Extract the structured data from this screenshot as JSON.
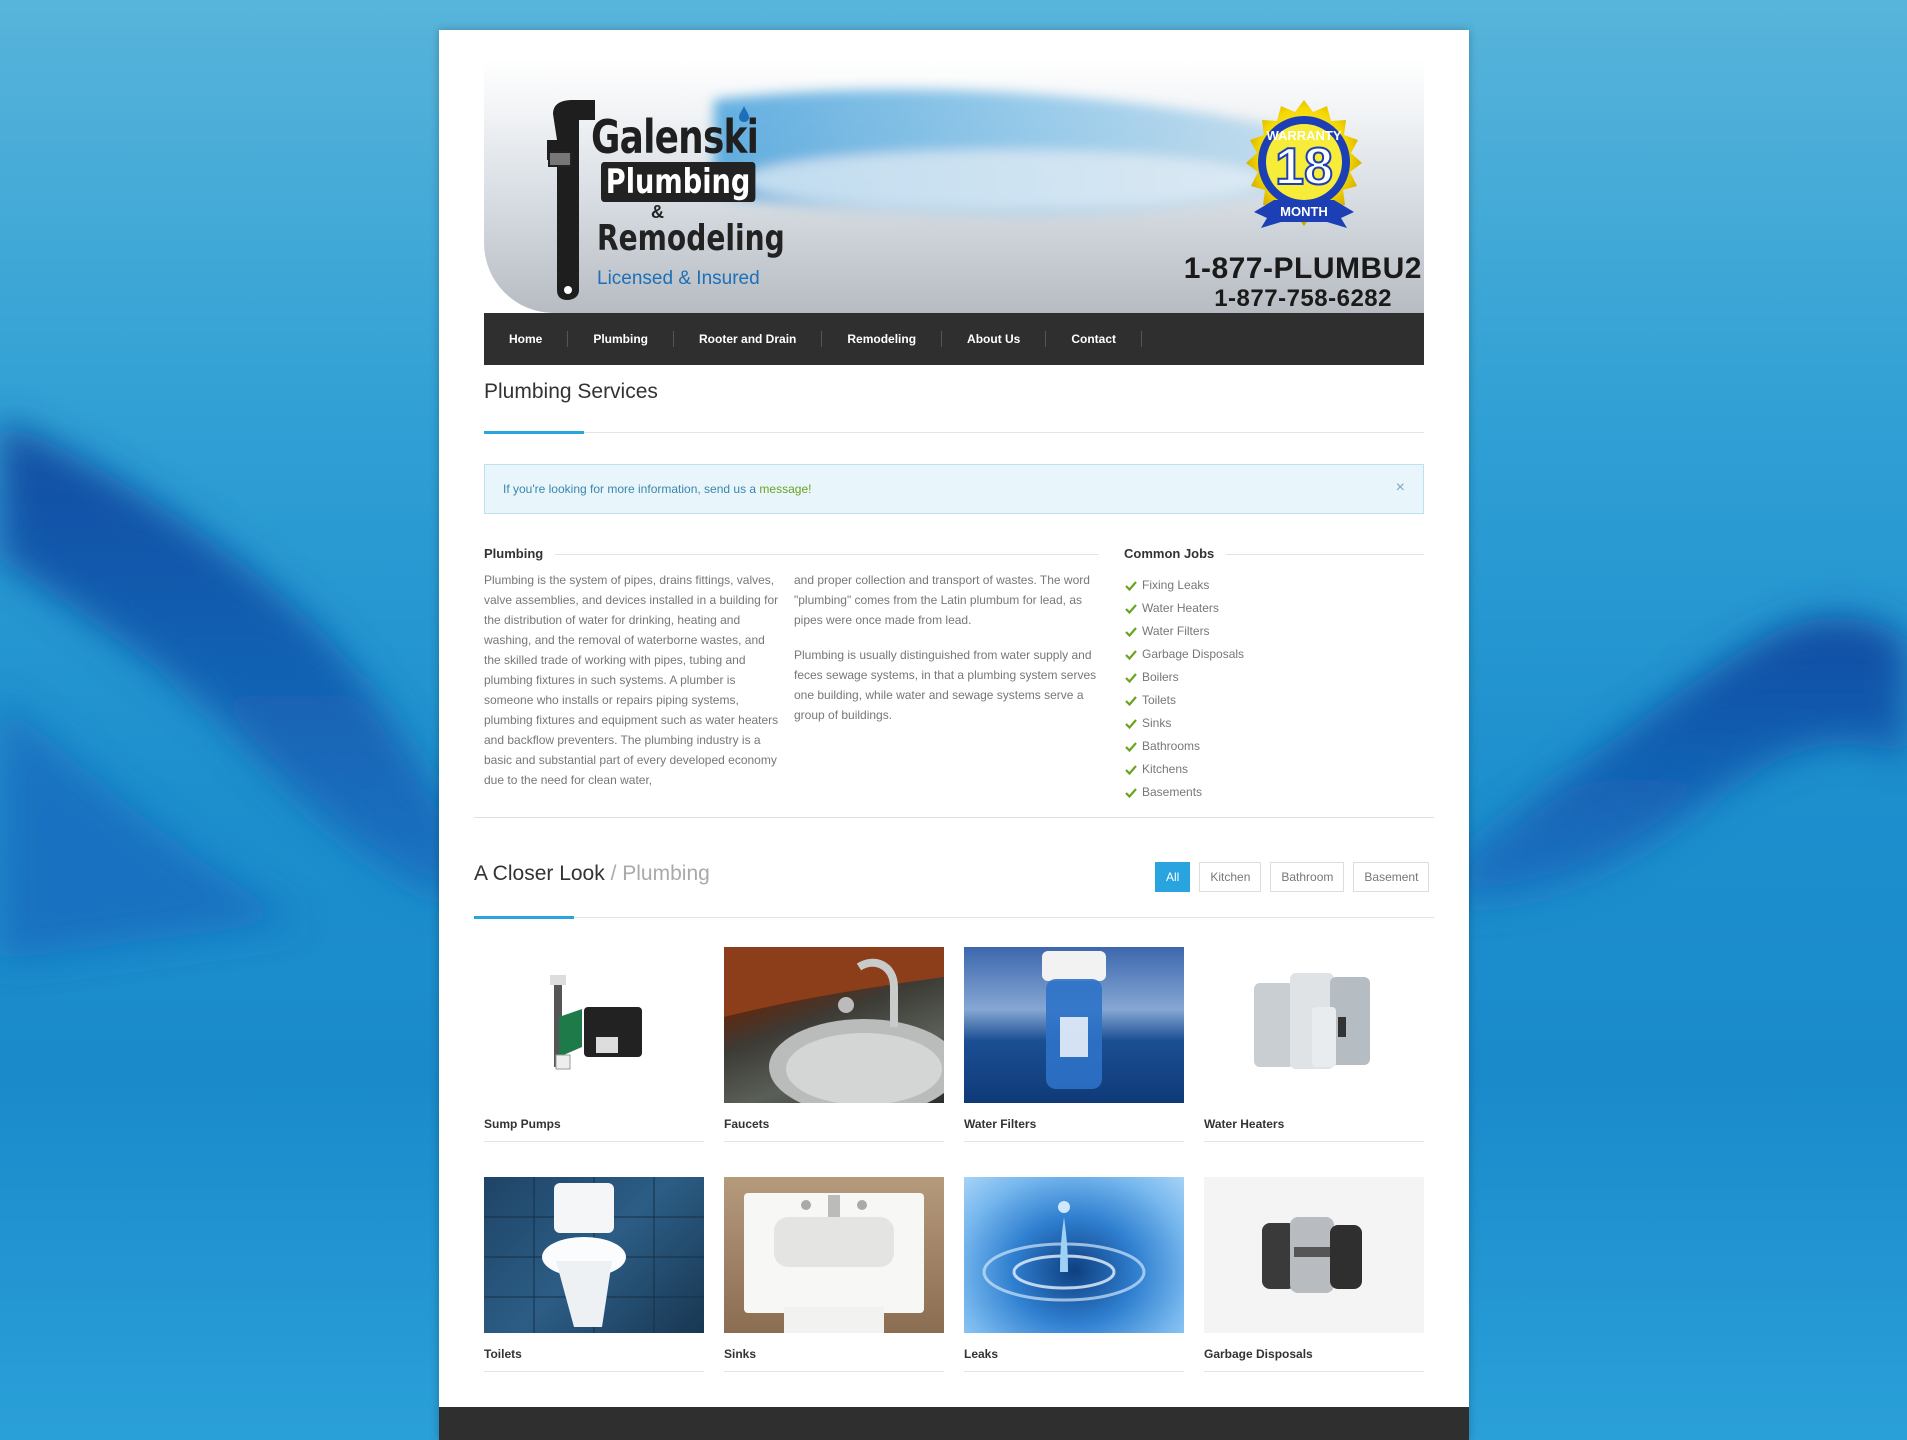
{
  "brand": {
    "logo_line1": "Galenski",
    "logo_line2": "Plumbing",
    "logo_amp": "&",
    "logo_line3": "Remodeling",
    "logo_tagline": "Licensed & Insured",
    "badge_top": "WARRANTY",
    "badge_number": "18",
    "badge_bottom": "MONTH",
    "phone_vanity": "1-877-PLUMBU2",
    "phone_numeric": "1-877-758-6282"
  },
  "nav": {
    "items": [
      {
        "label": "Home"
      },
      {
        "label": "Plumbing"
      },
      {
        "label": "Rooter and Drain"
      },
      {
        "label": "Remodeling"
      },
      {
        "label": "About Us"
      },
      {
        "label": "Contact"
      }
    ]
  },
  "page": {
    "title": "Plumbing Services"
  },
  "alert": {
    "text": "If you're looking for more information, send us a ",
    "link": "message!",
    "close": "×"
  },
  "plumbing": {
    "heading": "Plumbing",
    "col1": "Plumbing is the system of pipes, drains fittings, valves, valve assemblies, and devices installed in a building for the distribution of water for drinking, heating and washing, and the removal of waterborne wastes, and the skilled trade of working with pipes, tubing and plumbing fixtures in such systems. A plumber is someone who installs or repairs piping systems, plumbing fixtures and equipment such as water heaters and backflow preventers. The plumbing industry is a basic and substantial part of every developed economy due to the need for clean water,",
    "col2a": "and proper collection and transport of wastes. The word \"plumbing\" comes from the Latin plumbum for lead, as pipes were once made from lead.",
    "col2b": "Plumbing is usually distinguished from water supply and feces sewage systems, in that a plumbing system serves one building, while water and sewage systems serve a group of buildings."
  },
  "jobs": {
    "heading": "Common Jobs",
    "items": [
      "Fixing Leaks",
      "Water Heaters",
      "Water Filters",
      "Garbage Disposals",
      "Boilers",
      "Toilets",
      "Sinks",
      "Bathrooms",
      "Kitchens",
      "Basements"
    ]
  },
  "closer": {
    "title": "A Closer Look",
    "subtitle": " / Plumbing",
    "filters": [
      "All",
      "Kitchen",
      "Bathroom",
      "Basement"
    ],
    "active_filter": "All"
  },
  "gallery": [
    {
      "label": "Sump Pumps",
      "icon": "sump-pump-image"
    },
    {
      "label": "Faucets",
      "icon": "faucet-image"
    },
    {
      "label": "Water Filters",
      "icon": "water-filter-image"
    },
    {
      "label": "Water Heaters",
      "icon": "water-heater-image"
    },
    {
      "label": "Toilets",
      "icon": "toilet-image"
    },
    {
      "label": "Sinks",
      "icon": "sink-image"
    },
    {
      "label": "Leaks",
      "icon": "water-drop-image"
    },
    {
      "label": "Garbage Disposals",
      "icon": "garbage-disposal-image"
    }
  ],
  "colors": {
    "accent": "#2aa4de",
    "nav_bg": "#2f2f2f",
    "check": "#6aa41e",
    "alert_bg": "#e8f5fb"
  }
}
